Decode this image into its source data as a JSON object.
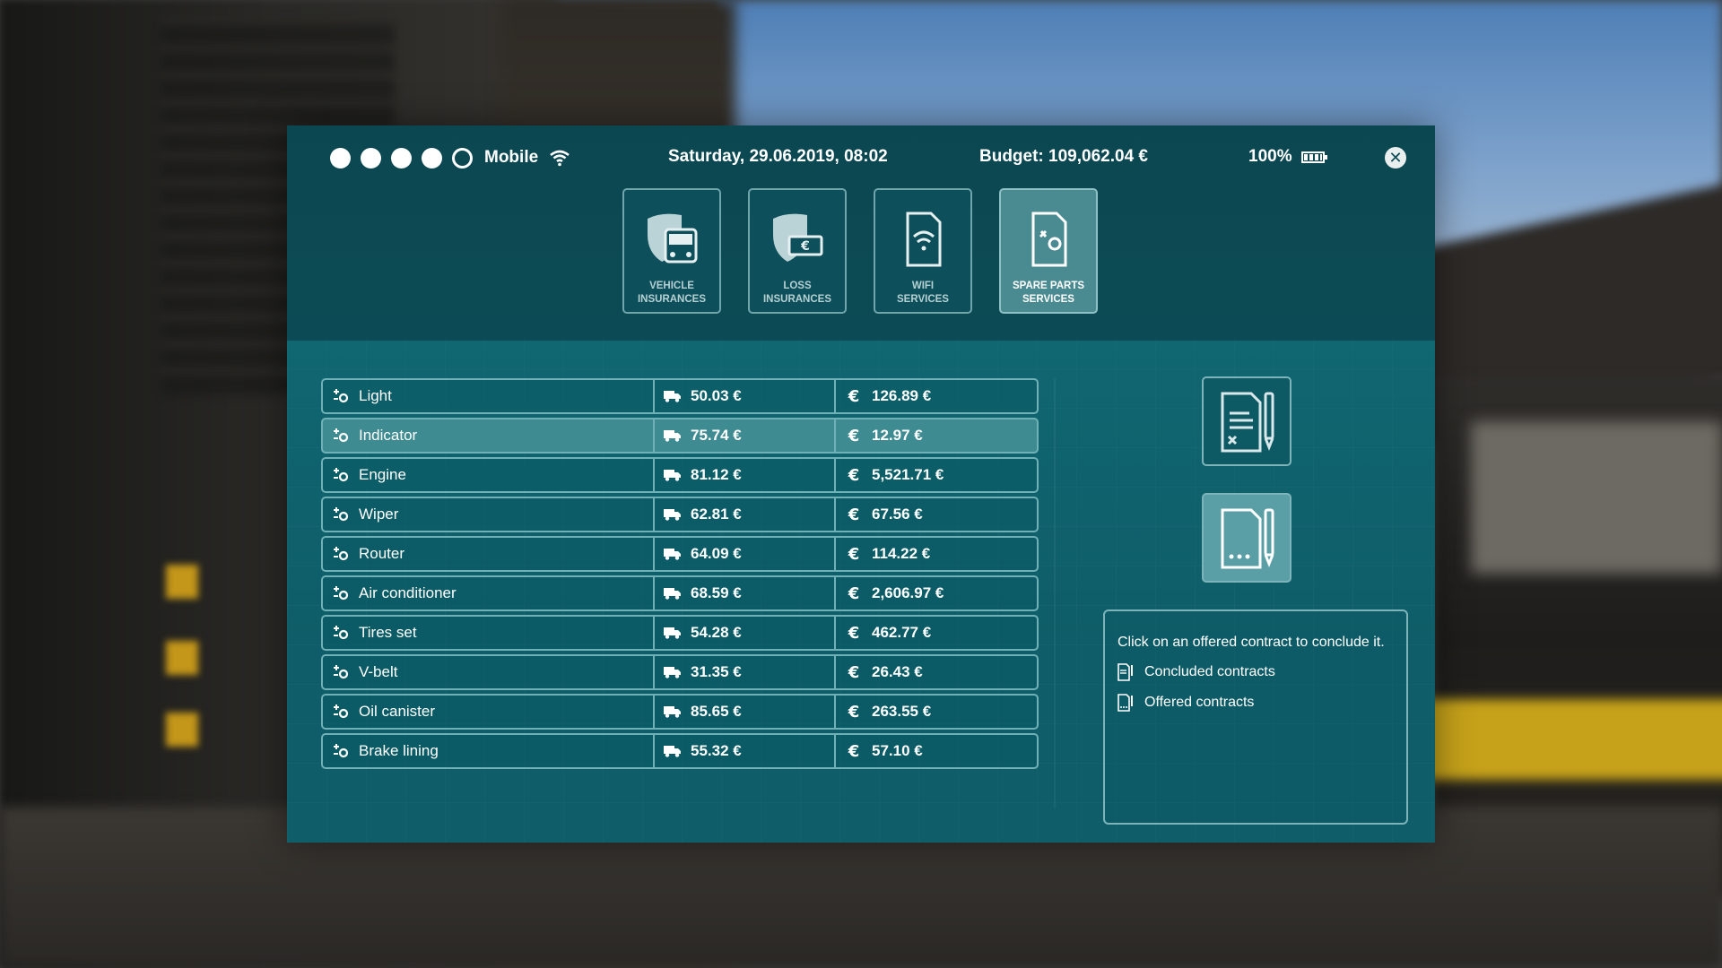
{
  "status": {
    "signal_filled": 4,
    "signal_total": 5,
    "carrier": "Mobile",
    "datetime": "Saturday, 29.06.2019, 08:02",
    "budget": "Budget: 109,062.04 €",
    "battery": "100%"
  },
  "tabs": [
    {
      "line1": "VEHICLE",
      "line2": "INSURANCES",
      "icon": "vehicle-insurance-icon",
      "active": false
    },
    {
      "line1": "LOSS",
      "line2": "INSURANCES",
      "icon": "loss-insurance-icon",
      "active": false
    },
    {
      "line1": "WIFI",
      "line2": "SERVICES",
      "icon": "wifi-service-icon",
      "active": false
    },
    {
      "line1": "SPARE PARTS",
      "line2": "SERVICES",
      "icon": "spare-parts-icon",
      "active": true
    }
  ],
  "rows": [
    {
      "name": "Light",
      "fee": "50.03 €",
      "price": "126.89 €"
    },
    {
      "name": "Indicator",
      "fee": "75.74 €",
      "price": "12.97 €",
      "selected": true
    },
    {
      "name": "Engine",
      "fee": "81.12 €",
      "price": "5,521.71 €"
    },
    {
      "name": "Wiper",
      "fee": "62.81 €",
      "price": "67.56 €"
    },
    {
      "name": "Router",
      "fee": "64.09 €",
      "price": "114.22 €"
    },
    {
      "name": "Air conditioner",
      "fee": "68.59 €",
      "price": "2,606.97 €"
    },
    {
      "name": "Tires set",
      "fee": "54.28 €",
      "price": "462.77 €"
    },
    {
      "name": "V-belt",
      "fee": "31.35 €",
      "price": "26.43 €"
    },
    {
      "name": "Oil canister",
      "fee": "85.65 €",
      "price": "263.55 €"
    },
    {
      "name": "Brake lining",
      "fee": "55.32 €",
      "price": "57.10 €"
    }
  ],
  "info": {
    "hint": "Click on an offered contract to conclude it.",
    "concluded": "Concluded contracts",
    "offered": "Offered contracts"
  },
  "colors": {
    "panel": "#0d4f5a",
    "border": "#6fb1b7",
    "selected": "#3e8b92",
    "active_tab": "#4a8b92"
  }
}
